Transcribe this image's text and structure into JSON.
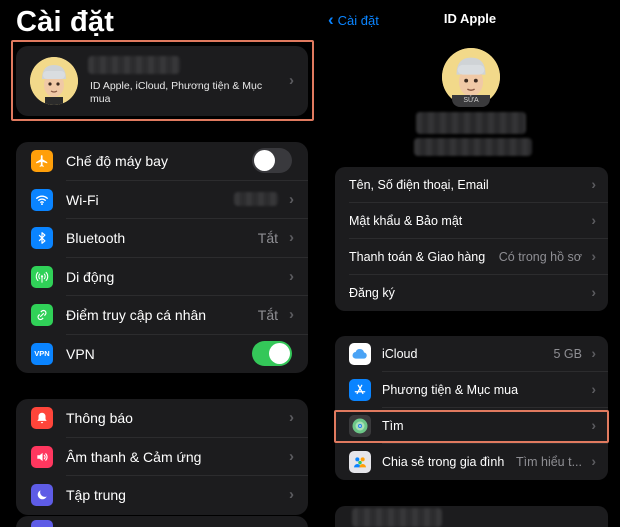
{
  "left": {
    "title": "Cài đặt",
    "profile": {
      "subtitle": "ID Apple, iCloud, Phương tiện & Mục mua"
    },
    "group1": [
      {
        "label": "Chế độ máy bay",
        "icon": "airplane-icon",
        "color": "#ff9f0a",
        "control": "toggle-off"
      },
      {
        "label": "Wi-Fi",
        "icon": "wifi-icon",
        "color": "#0a84ff",
        "control": "blurred"
      },
      {
        "label": "Bluetooth",
        "icon": "bluetooth-icon",
        "color": "#0a84ff",
        "value": "Tắt"
      },
      {
        "label": "Di động",
        "icon": "antenna-icon",
        "color": "#30d158"
      },
      {
        "label": "Điểm truy cập cá nhân",
        "icon": "hotspot-icon",
        "color": "#30d158",
        "value": "Tắt"
      },
      {
        "label": "VPN",
        "icon": "vpn-icon",
        "color": "#0a84ff",
        "control": "toggle-on"
      }
    ],
    "group2": [
      {
        "label": "Thông báo",
        "icon": "bell-icon",
        "color": "#ff453a"
      },
      {
        "label": "Âm thanh & Cảm ứng",
        "icon": "speaker-icon",
        "color": "#ff375f"
      },
      {
        "label": "Tập trung",
        "icon": "moon-icon",
        "color": "#5e5ce6"
      }
    ]
  },
  "right": {
    "back_label": "Cài đặt",
    "title": "ID Apple",
    "edit_label": "SỬA",
    "group1": [
      {
        "label": "Tên, Số điện thoại, Email"
      },
      {
        "label": "Mật khẩu & Bảo mật"
      },
      {
        "label": "Thanh toán & Giao hàng",
        "value": "Có trong hồ sơ"
      },
      {
        "label": "Đăng ký"
      }
    ],
    "group2": [
      {
        "label": "iCloud",
        "value": "5 GB",
        "icon": "cloud-icon"
      },
      {
        "label": "Phương tiện & Mục mua",
        "icon": "app-store-icon"
      },
      {
        "label": "Tìm",
        "icon": "find-my-icon"
      },
      {
        "label": "Chia sẻ trong gia đình",
        "value": "Tìm hiểu t...",
        "icon": "family-icon"
      }
    ]
  },
  "colors": {
    "accent": "#0a84ff",
    "highlight": "#e07a5f",
    "toggle_on": "#34c759"
  }
}
